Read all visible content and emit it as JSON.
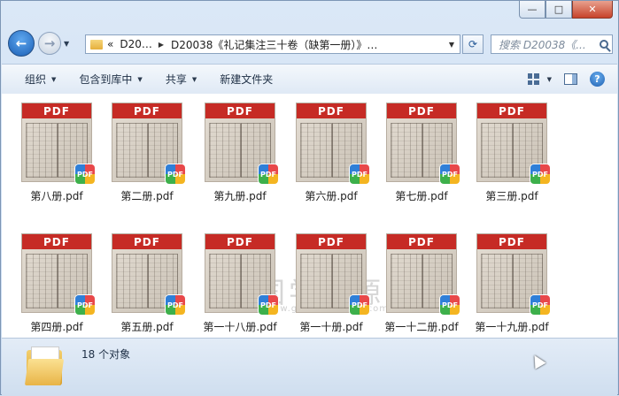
{
  "window_controls": {
    "minimize": "—",
    "maximize": "□",
    "close": "✕"
  },
  "nav": {
    "back_icon": "arrow-left-icon",
    "forward_icon": "arrow-right-icon",
    "back_glyph": "←",
    "forward_glyph": "→"
  },
  "address": {
    "prefix": "«",
    "crumbs": [
      "D20…",
      "D20038《礼记集注三十卷（缺第一册）》…"
    ]
  },
  "search": {
    "placeholder": "搜索 D20038《..."
  },
  "toolbar": {
    "organize": "组织",
    "include_library": "包含到库中",
    "share": "共享",
    "new_folder": "新建文件夹"
  },
  "watermark": {
    "text": "国学资源网",
    "url": "www.guoxueziyuan.com",
    "seal": "国"
  },
  "files": [
    {
      "name": "第八册.pdf",
      "thumb_label": "PDF",
      "badge": "PDF"
    },
    {
      "name": "第二册.pdf",
      "thumb_label": "PDF",
      "badge": "PDF"
    },
    {
      "name": "第九册.pdf",
      "thumb_label": "PDF",
      "badge": "PDF"
    },
    {
      "name": "第六册.pdf",
      "thumb_label": "PDF",
      "badge": "PDF"
    },
    {
      "name": "第七册.pdf",
      "thumb_label": "PDF",
      "badge": "PDF"
    },
    {
      "name": "第三册.pdf",
      "thumb_label": "PDF",
      "badge": "PDF"
    },
    {
      "name": "第四册.pdf",
      "thumb_label": "PDF",
      "badge": "PDF"
    },
    {
      "name": "第五册.pdf",
      "thumb_label": "PDF",
      "badge": "PDF"
    },
    {
      "name": "第一十八册.pdf",
      "thumb_label": "PDF",
      "badge": "PDF"
    },
    {
      "name": "第一十册.pdf",
      "thumb_label": "PDF",
      "badge": "PDF"
    },
    {
      "name": "第一十二册.pdf",
      "thumb_label": "PDF",
      "badge": "PDF"
    },
    {
      "name": "第一十九册.pdf",
      "thumb_label": "PDF",
      "badge": "PDF"
    }
  ],
  "status": {
    "count_text": "18 个对象"
  },
  "colors": {
    "pdf_band": "#c62b25",
    "window_frame": "#dbe8f7"
  }
}
